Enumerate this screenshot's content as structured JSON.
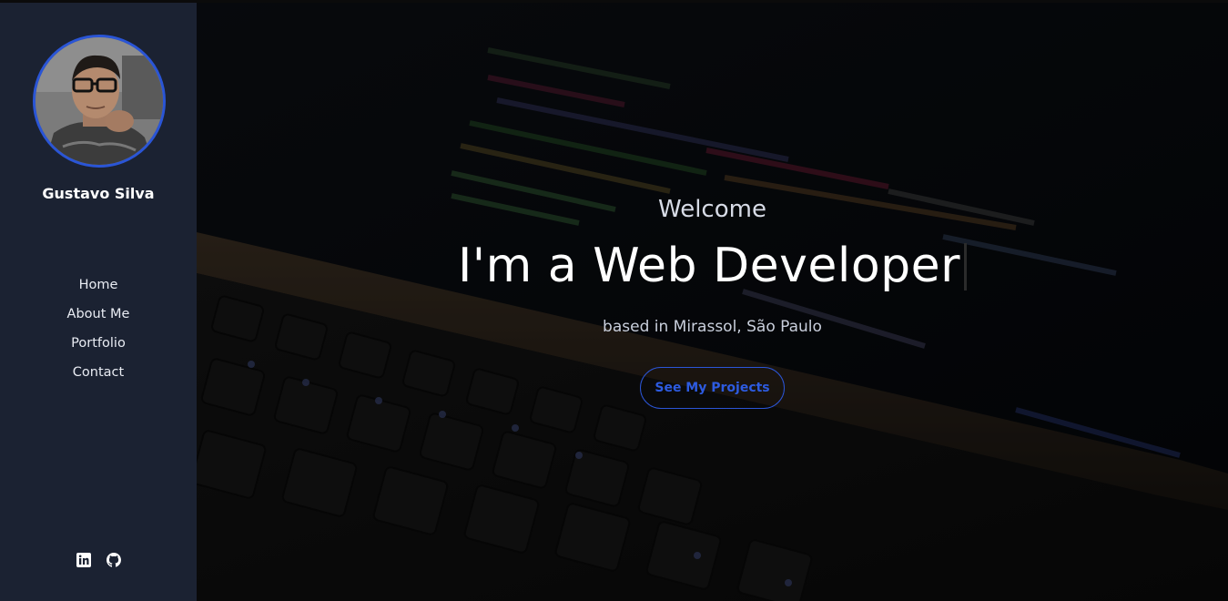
{
  "profile": {
    "name": "Gustavo Silva"
  },
  "nav": {
    "items": [
      {
        "label": "Home"
      },
      {
        "label": "About Me"
      },
      {
        "label": "Portfolio"
      },
      {
        "label": "Contact"
      }
    ]
  },
  "social": {
    "links": [
      {
        "icon": "linkedin-icon"
      },
      {
        "icon": "github-icon"
      }
    ]
  },
  "hero": {
    "welcome": "Welcome",
    "headline_prefix": "I'm a",
    "headline_role": "Web Developer",
    "location": "based in Mirassol, São Paulo",
    "cta_label": "See My Projects"
  },
  "colors": {
    "sidebar_bg": "#1b2232",
    "accent": "#2a55d6",
    "text_primary": "#ffffff"
  }
}
